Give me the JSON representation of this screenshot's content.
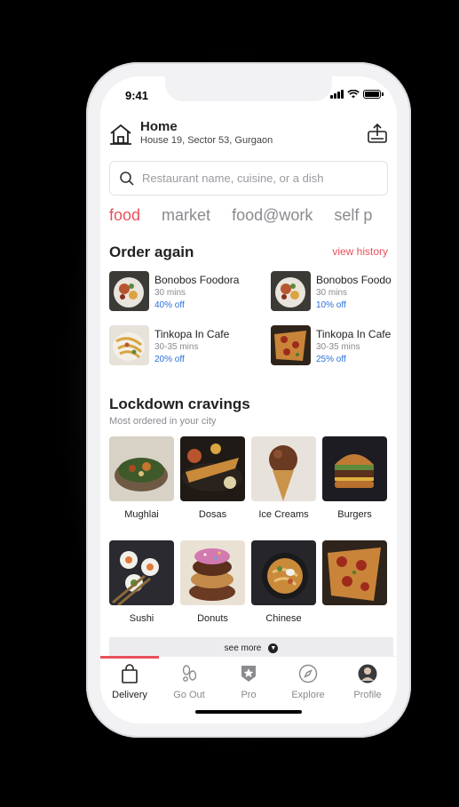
{
  "status_bar": {
    "time": "9:41"
  },
  "header": {
    "title": "Home",
    "address": "House 19, Sector 53, Gurgaon"
  },
  "search": {
    "placeholder": "Restaurant name, cuisine, or a dish"
  },
  "tabs": [
    {
      "label": "food",
      "active": true
    },
    {
      "label": "market"
    },
    {
      "label": "food@work"
    },
    {
      "label": "self p"
    }
  ],
  "order_again": {
    "title": "Order again",
    "view_history": "view history",
    "items": [
      {
        "name": "Bonobos Foodora",
        "time": "30 mins",
        "offer": "40% off"
      },
      {
        "name": "Bonobos Foodo",
        "time": "30 mins",
        "offer": "10% off"
      },
      {
        "name": "Tinkopa In Cafe",
        "time": "30-35 mins",
        "offer": "20% off"
      },
      {
        "name": "Tinkopa In Cafe",
        "time": "30-35 mins",
        "offer": "25% off"
      }
    ]
  },
  "cravings": {
    "title": "Lockdown cravings",
    "subtitle": "Most ordered in your city",
    "items": [
      {
        "label": "Mughlai"
      },
      {
        "label": "Dosas"
      },
      {
        "label": "Ice Creams"
      },
      {
        "label": "Burgers"
      },
      {
        "label": "Sushi"
      },
      {
        "label": "Donuts"
      },
      {
        "label": "Chinese"
      },
      {
        "label": ""
      }
    ],
    "see_more": "see more"
  },
  "bottom_nav": [
    {
      "label": "Delivery",
      "icon": "shopping-bag-icon",
      "active": true
    },
    {
      "label": "Go Out",
      "icon": "footprints-icon"
    },
    {
      "label": "Pro",
      "icon": "pro-star-icon"
    },
    {
      "label": "Explore",
      "icon": "compass-icon"
    },
    {
      "label": "Profile",
      "icon": "avatar-icon"
    }
  ],
  "colors": {
    "accent": "#e8505b",
    "offer": "#2b6fd8"
  }
}
